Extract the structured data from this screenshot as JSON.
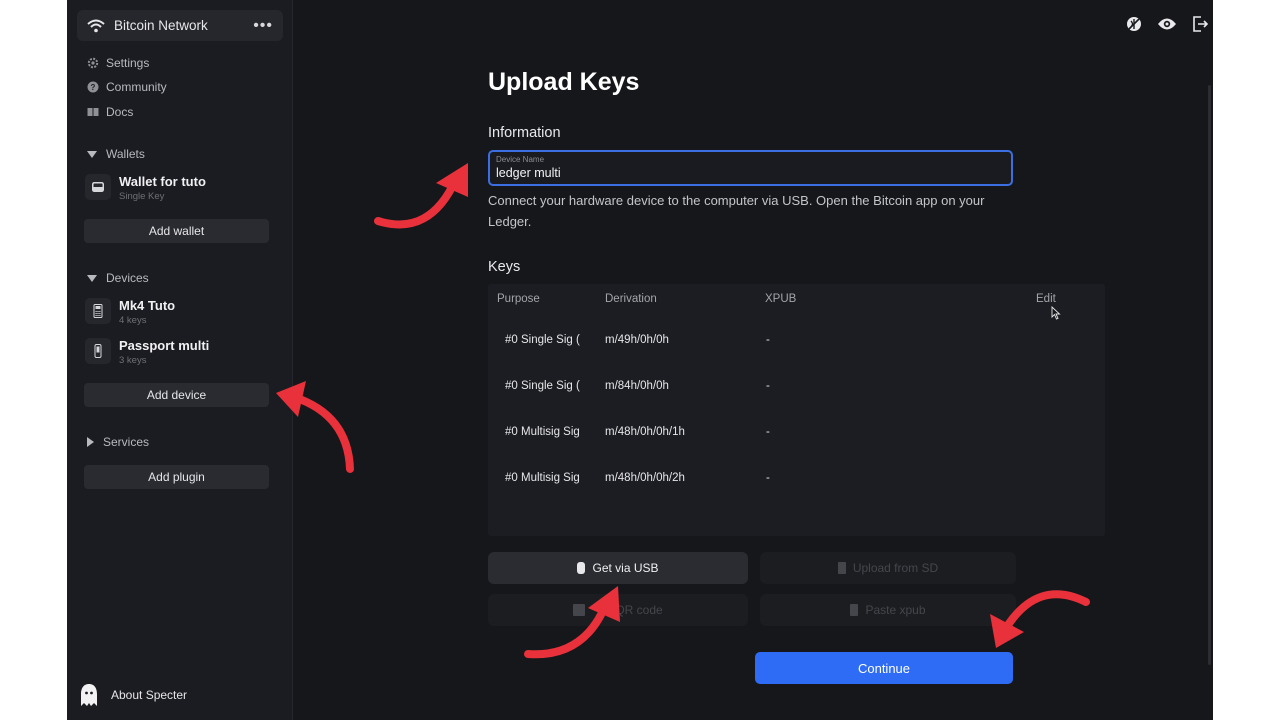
{
  "sidebar": {
    "network": "Bitcoin Network",
    "more": "•••",
    "menu": [
      {
        "label": "Settings",
        "icon": "gear-icon"
      },
      {
        "label": "Community",
        "icon": "question-icon"
      },
      {
        "label": "Docs",
        "icon": "book-icon"
      }
    ],
    "wallets_title": "Wallets",
    "wallets": [
      {
        "name": "Wallet for tuto",
        "sub": "Single Key",
        "icon": "wallet-icon"
      }
    ],
    "add_wallet": "Add wallet",
    "devices_title": "Devices",
    "devices": [
      {
        "name": "Mk4 Tuto",
        "sub": "4 keys",
        "icon": "coldcard-icon"
      },
      {
        "name": "Passport multi",
        "sub": "3 keys",
        "icon": "passport-icon"
      }
    ],
    "add_device": "Add device",
    "services_title": "Services",
    "add_plugin": "Add plugin",
    "about": "About Specter"
  },
  "main": {
    "title": "Upload Keys",
    "information": "Information",
    "device_name_label": "Device Name",
    "device_name_value": "ledger multi",
    "hint": "Connect your hardware device to the computer via USB. Open the Bitcoin app on your Ledger.",
    "keys_title": "Keys",
    "columns": {
      "purpose": "Purpose",
      "derivation": "Derivation",
      "xpub": "XPUB",
      "edit": "Edit"
    },
    "rows": [
      {
        "purpose": "#0 Single Sig (",
        "derivation": "m/49h/0h/0h",
        "xpub": "-"
      },
      {
        "purpose": "#0 Single Sig (",
        "derivation": "m/84h/0h/0h",
        "xpub": "-"
      },
      {
        "purpose": "#0 Multisig Sig",
        "derivation": "m/48h/0h/0h/1h",
        "xpub": "-"
      },
      {
        "purpose": "#0 Multisig Sig",
        "derivation": "m/48h/0h/0h/2h",
        "xpub": "-"
      }
    ],
    "buttons": {
      "usb": "Get via USB",
      "sd": "Upload from SD",
      "qr": "QR code",
      "paste": "Paste xpub",
      "continue": "Continue"
    }
  },
  "colors": {
    "accent": "#2e6cf6",
    "annotation_arrow": "#e8313a",
    "background": "#16171b",
    "sidebar": "#1b1c21"
  }
}
